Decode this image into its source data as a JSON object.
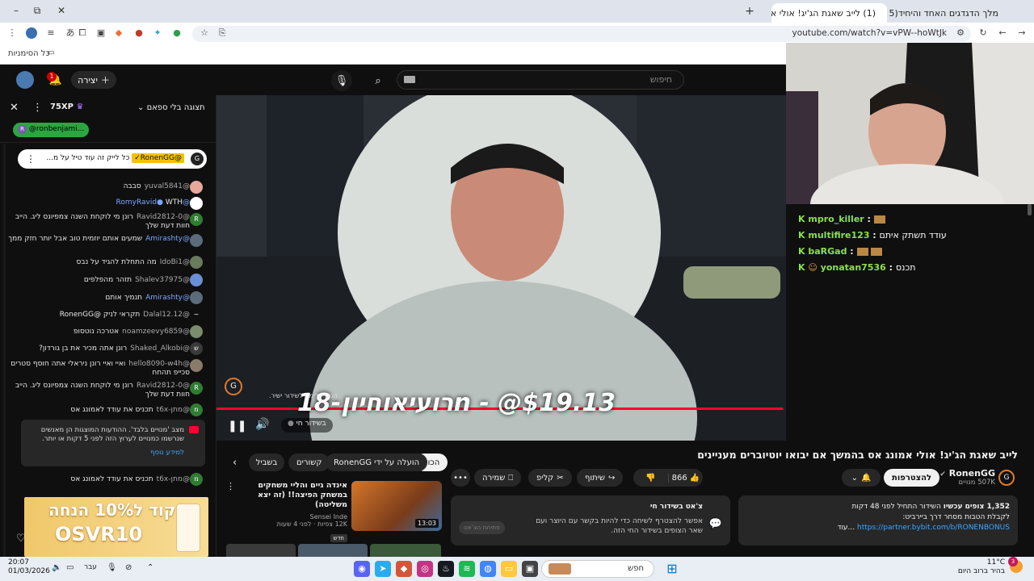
{
  "browser": {
    "tabs": [
      {
        "label": "(1) לייב שאגת הג'יג! אולי א",
        "active": true
      },
      {
        "label": "מלך הדגדגים האחד והיחיד(15)",
        "active": false
      }
    ],
    "new_tab": "+",
    "url": "youtube.com/watch?v=vPW--hoWtJk",
    "bookmarks_label": "כל הסימניות",
    "win_min": "–",
    "win_max": "⧉",
    "win_close": "✕"
  },
  "yt_header": {
    "search_placeholder": "חיפוש",
    "create_label": "יצירה",
    "notif_count": "1"
  },
  "chat": {
    "mode_label": "תצוגה בלי ספאם",
    "xp_badge": "75XP",
    "mention_chip": "@ronbenjami...",
    "pinned": {
      "author": "@RonenGG✓",
      "text": "כל לייק זה עוד טיל על מ..."
    },
    "messages": [
      {
        "author": "@yuval5841",
        "text": "סבבה",
        "avatar_color": "#e8a89a",
        "avatar_letter": ""
      },
      {
        "author": "@RomyRavid",
        "text": "WTH",
        "avatar_color": "#ffffff",
        "avatar_letter": "",
        "verified": true
      },
      {
        "author": "@Ravid2812-0",
        "text": "רונן מי לוקחת השנה צמפיונס ליג. הייב חוות דעת שלך",
        "avatar_color": "#2e7d32",
        "avatar_letter": "R"
      },
      {
        "author": "@Amirashty",
        "text": "שמעים אותם יוזמית טוב אבל יותר חזק ממך",
        "avatar_color": "#5c6b7a",
        "avatar_letter": "",
        "verified": true
      },
      {
        "author": "@IdoBi1",
        "text": "מה התחלת להגיד על נבס",
        "avatar_color": "#6a7a5c",
        "avatar_letter": ""
      },
      {
        "author": "@Shalev37975",
        "text": "תזהר מהפלפים",
        "avatar_color": "#6b8fd6",
        "avatar_letter": ""
      },
      {
        "author": "@Amirashty",
        "text": "תנמיך אותם",
        "avatar_color": "#5c6b7a",
        "avatar_letter": "",
        "verified": true
      },
      {
        "author": "@Dalal12.12",
        "text": "תקראי לניק @RonenGG",
        "avatar_color": "#0f0f0f",
        "avatar_letter": "~"
      },
      {
        "author": "@noamzeevy6859",
        "text": "אטרכה נוטסופ",
        "avatar_color": "#7a8c6a",
        "avatar_letter": ""
      },
      {
        "author": "@Shaked_Alkobi",
        "text": "רונן אתה מכיר את בן גורדון?",
        "avatar_color": "#3a3a3a",
        "avatar_letter": "ש"
      },
      {
        "author": "@hello8090-w4h",
        "text": "ואיי ואיי רונן ניראלי אתה חוסף סטרים סכייפ תהחח",
        "avatar_color": "#8a7a6a",
        "avatar_letter": ""
      },
      {
        "author": "@Ravid2812-0",
        "text": "רונן מי לוקחת השנה צמפיונס ליג. הייב חוות דעת שלך",
        "avatar_color": "#2e7d32",
        "avatar_letter": "R"
      },
      {
        "author": "@מתן-t6x",
        "text": "תכניס את עודד לאמונג אס",
        "avatar_color": "#2e7d32",
        "avatar_letter": "מ"
      }
    ],
    "notice": {
      "text": "מצב 'מנויים בלבד'. ההודעות המוצגות הן מאנשים שנרשמו כמנויים לערוץ הזה לפני 5 דקות או יותר.",
      "link": "למידע נוסף"
    },
    "last_message": {
      "author": "@מתן-t6x",
      "text": "תכניס את עודד לאמונג אס"
    },
    "ad_text_top": "קוד ל10% הנחה",
    "ad_text_bottom": "OSVR10"
  },
  "video": {
    "overlay_text": "רועיאוחיון-18n - @$19.13",
    "small_caption_1": "הגיע קדימה לשידור ישיר.",
    "live_label": "בשידור חי",
    "progress_fraction": 0.995
  },
  "overlay_chat": {
    "messages": [
      {
        "user": "mpro_killer",
        "text": "",
        "color": "#8be04e"
      },
      {
        "user": "multifire123",
        "text": "עודד תשתק איתם",
        "color": "#8be04e"
      },
      {
        "user": "baRGad",
        "text": "",
        "color": "#8be04e"
      },
      {
        "user": "yonatan7536",
        "text": "תכנס",
        "color": "#8be04e"
      }
    ]
  },
  "below": {
    "title": "לייב שאגת הג'יג! אולי אמונג אס בהמשך אם יבואו יוטיוברים מעניינים",
    "channel": "RonenGG",
    "subs": "507K מנויים",
    "subscribe": "להצטרפות",
    "likes": "866",
    "share": "שיתוף",
    "clip": "קליפ",
    "save": "שמירה",
    "more": "•••",
    "filters": [
      "הכול",
      "הועלה על ידי RonenGG",
      "קשורים",
      "בשביל"
    ],
    "desc_views": "1,352 צופים עכשיו",
    "desc_started": "השידור התחיל לפני 48 דקות",
    "desc_line2": "לקבלת הטבות מסחר דרך ביירביט:",
    "desc_link": "https://partner.bybit.com/b/RONENBONUS",
    "desc_more": "...עוד",
    "live_box_title": "צ'אט בשידור חי",
    "live_box_text": "אפשר להצטרף לשיחה כדי להיות בקשר עם היוצר ועם שאר הצופים בשידור החי הזה.",
    "live_box_btn": "פתיחת הצ'אט",
    "rec_title": "אינדה גיים והליי משחקים במשחק הפיצה!! (זה יצא משליטה)",
    "rec_channel": "Sensei Inde",
    "rec_meta": "12K צפיות · לפני 4 שעות",
    "rec_duration": "13:03",
    "rec_badge": "חדש"
  },
  "taskbar": {
    "time": "20:07",
    "date": "01/03/2026",
    "lang": "עבר",
    "search": "חפש",
    "weather_temp": "11°C",
    "weather_text": "בהיר ברוב היום",
    "notif": "3"
  },
  "colors": {
    "accent_red": "#ff0033",
    "link_blue": "#3ea6ff"
  }
}
